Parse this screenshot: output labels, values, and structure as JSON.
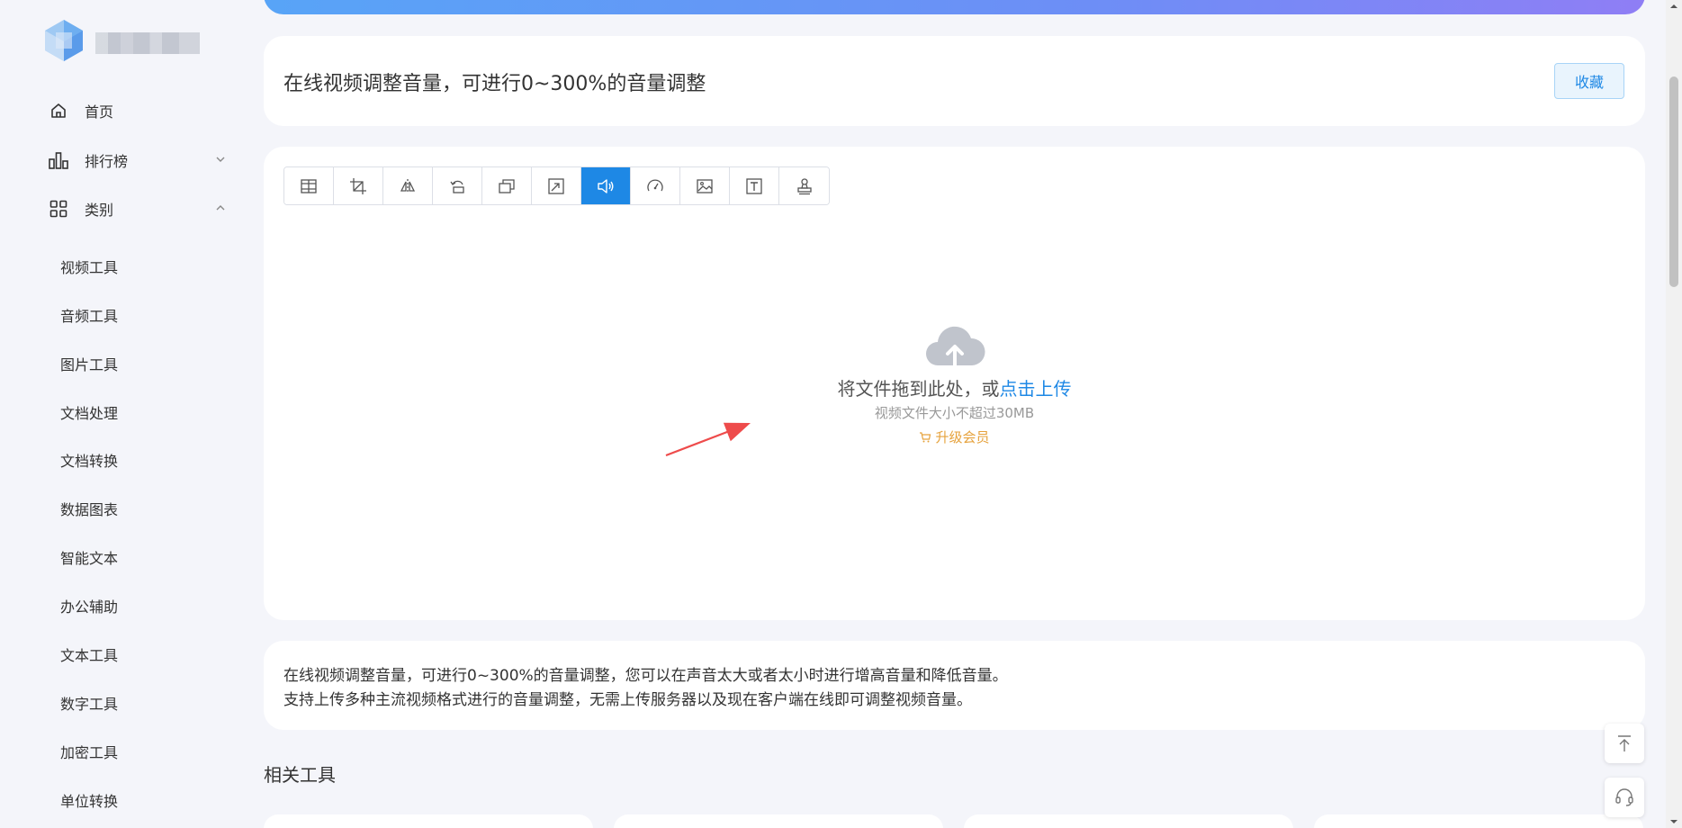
{
  "sidebar": {
    "nav": [
      {
        "label": "首页",
        "icon": "home-icon"
      },
      {
        "label": "排行榜",
        "icon": "bar-chart-icon",
        "expand": "chevron-down-icon"
      },
      {
        "label": "类别",
        "icon": "grid-icon",
        "expand": "chevron-up-icon"
      }
    ],
    "categories": [
      "视频工具",
      "音频工具",
      "图片工具",
      "文档处理",
      "文档转换",
      "数据图表",
      "智能文本",
      "办公辅助",
      "文本工具",
      "数字工具",
      "加密工具",
      "单位转换"
    ]
  },
  "header": {
    "title": "在线视频调整音量，可进行0~300%的音量调整",
    "favorite_label": "收藏"
  },
  "toolbar": {
    "tools": [
      "video-split-icon",
      "crop-icon",
      "flip-icon",
      "rotate-icon",
      "aspect-icon",
      "resize-icon",
      "volume-icon",
      "speed-icon",
      "image-icon",
      "text-icon",
      "stamp-icon"
    ],
    "active": "volume-icon"
  },
  "upload": {
    "icon": "cloud-upload-icon",
    "drop_text": "将文件拖到此处，或",
    "click_text": "点击上传",
    "hint": "视频文件大小不超过30MB",
    "upgrade_label": "升级会员",
    "upgrade_icon": "cart-icon"
  },
  "description": {
    "line1": "在线视频调整音量，可进行0~300%的音量调整，您可以在声音太大或者太小时进行增高音量和降低音量。",
    "line2": "支持上传多种主流视频格式进行的音量调整，无需上传服务器以及现在客户端在线即可调整视频音量。"
  },
  "related": {
    "title": "相关工具"
  },
  "float_buttons": [
    "back-to-top-icon",
    "headset-icon"
  ],
  "colors": {
    "accent": "#1e88e5",
    "upgrade": "#e6a23c",
    "annotation_arrow": "#ee4b4b"
  }
}
